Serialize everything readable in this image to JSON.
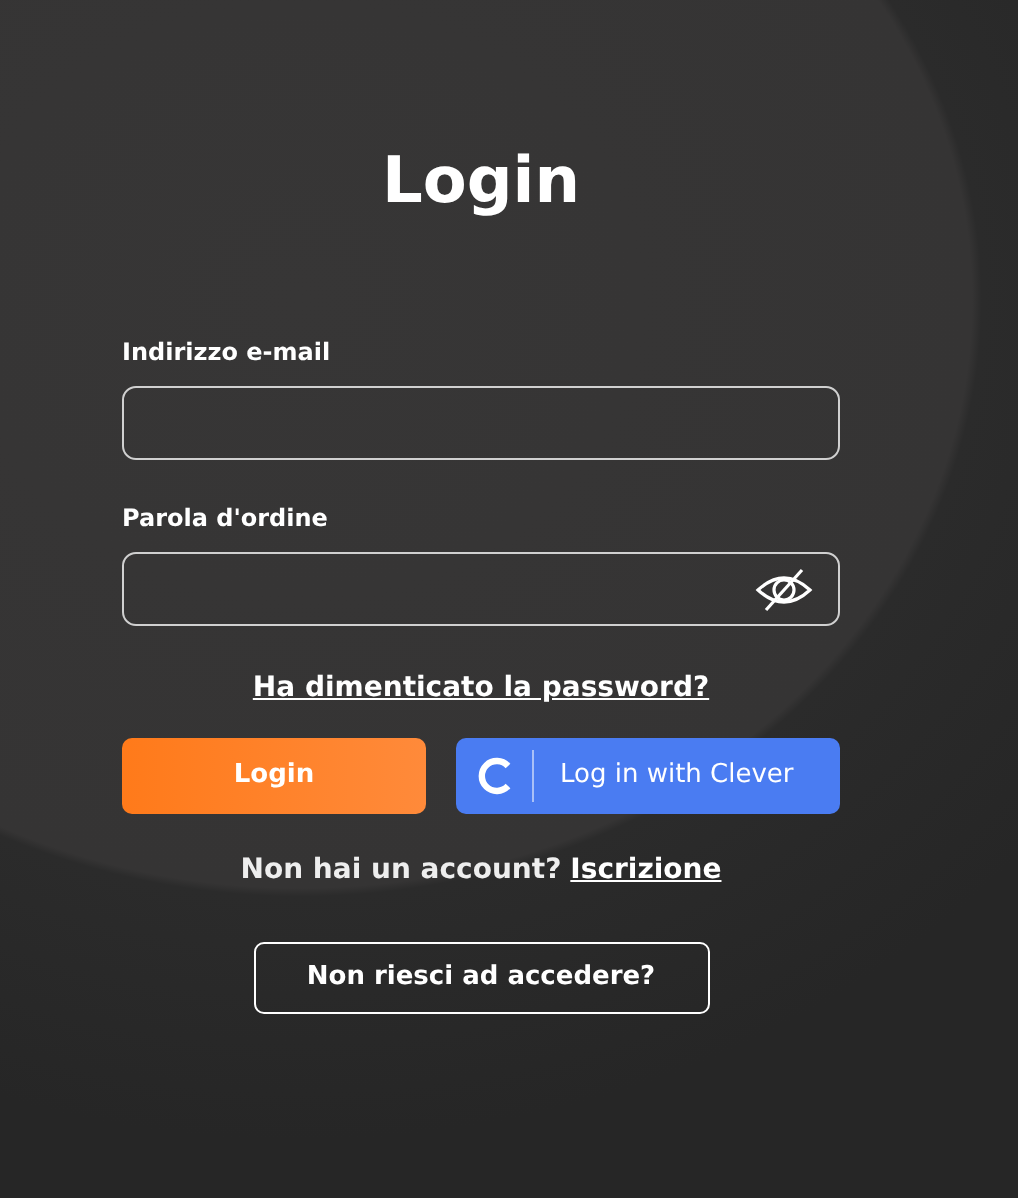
{
  "title": "Login",
  "fields": [
    {
      "label": "Indirizzo e-mail",
      "kind": "email"
    },
    {
      "label": "Parola d'ordine",
      "kind": "password"
    }
  ],
  "forgot_link": "Ha dimenticato la password?",
  "login_button": "Login",
  "clever_button": "Log in with Clever",
  "signup": {
    "text": "Non hai un account?",
    "link": "Iscrizione"
  },
  "help_button": "Non riesci ad accedere?"
}
